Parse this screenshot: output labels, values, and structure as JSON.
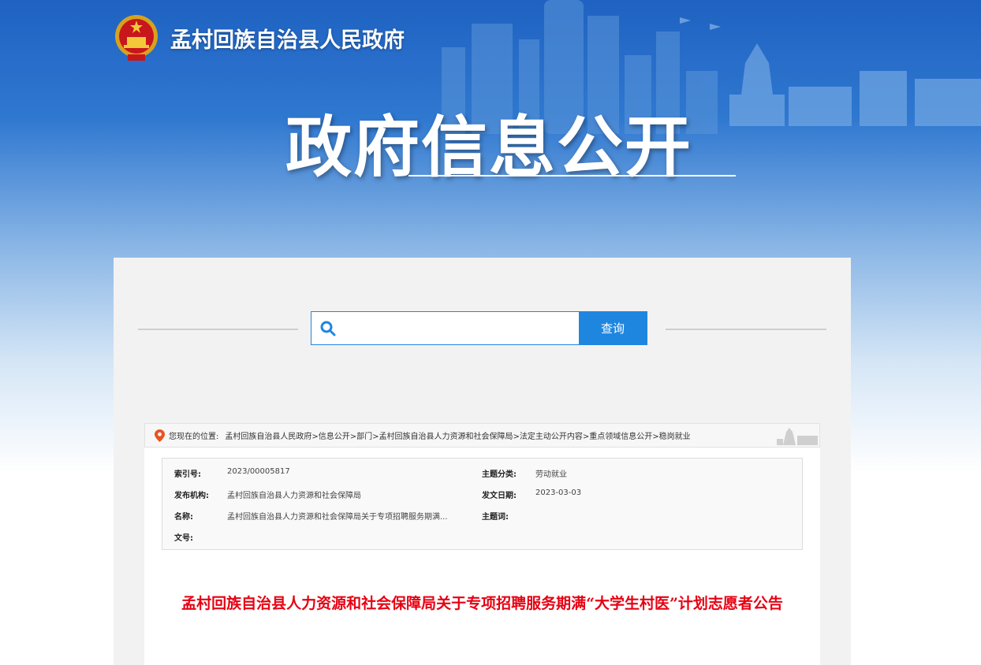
{
  "header": {
    "site_name": "孟村回族自治县人民政府",
    "hero_title": "政府信息公开",
    "emblem_icon": "national-emblem-icon"
  },
  "search": {
    "placeholder": "",
    "value": "",
    "button_label": "查询"
  },
  "breadcrumb": {
    "prefix": "您现在的位置:",
    "path": "孟村回族自治县人民政府>信息公开>部门>孟村回族自治县人力资源和社会保障局>法定主动公开内容>重点领域信息公开>稳岗就业"
  },
  "meta": {
    "index_label": "索引号:",
    "index_value": "2023/00005817",
    "category_label": "主题分类:",
    "category_value": "劳动就业",
    "publisher_label": "发布机构:",
    "publisher_value": "孟村回族自治县人力资源和社会保障局",
    "date_label": "发文日期:",
    "date_value": "2023-03-03",
    "name_label": "名称:",
    "name_value": "孟村回族自治县人力资源和社会保障局关于专项招聘服务期满...",
    "keywords_label": "主题词:",
    "keywords_value": "",
    "docno_label": "文号:",
    "docno_value": ""
  },
  "article": {
    "title": "孟村回族自治县人力资源和社会保障局关于专项招聘服务期满“大学生村医”计划志愿者公告"
  },
  "colors": {
    "accent": "#1f86e0",
    "title_red": "#e60012",
    "header_blue": "#1f62c2"
  }
}
